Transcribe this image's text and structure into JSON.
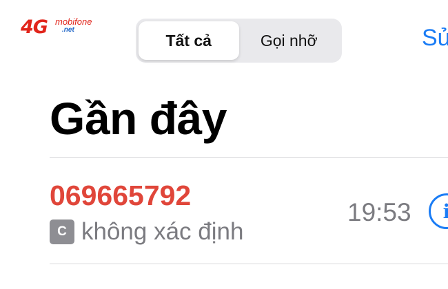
{
  "status_bar": {
    "carrier_logo": {
      "main": "4G",
      "brand": "mobifone",
      "suffix": ".net"
    }
  },
  "header": {
    "tabs": [
      {
        "label": "Tất cả",
        "selected": true
      },
      {
        "label": "Gọi nhỡ",
        "selected": false
      }
    ],
    "edit_label": "Sửa"
  },
  "page": {
    "title": "Gần đây"
  },
  "recents": [
    {
      "number": "069665792",
      "missed": true,
      "type_badge": "C",
      "label": "không xác định",
      "time": "19:53",
      "info_icon": "info-icon"
    }
  ],
  "colors": {
    "accent": "#1a7cf5",
    "missed_call": "#e0463a",
    "secondary_text": "#7b7b80",
    "carrier_red": "#e1251b",
    "carrier_blue": "#1d64c7"
  }
}
